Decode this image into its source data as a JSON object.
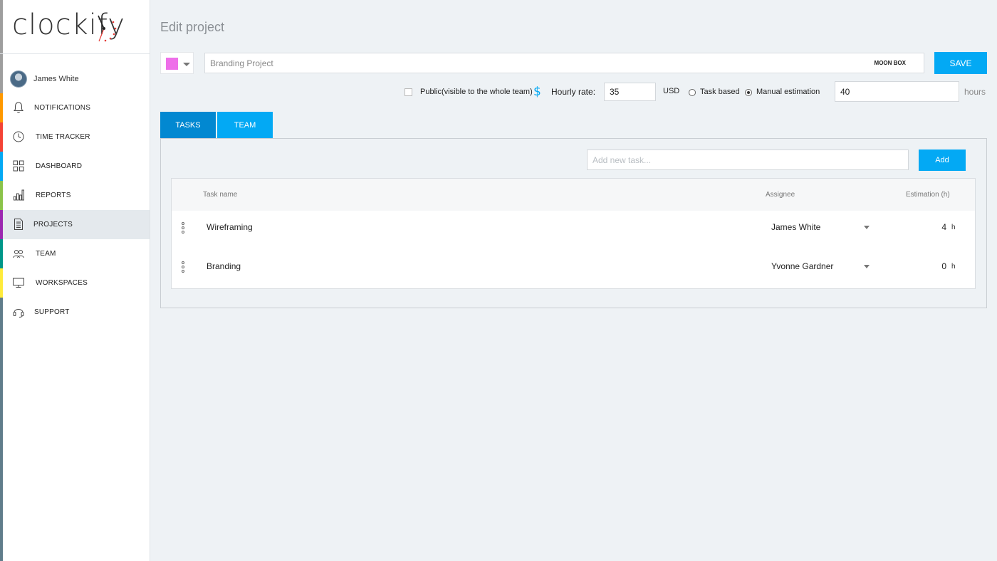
{
  "app": {
    "logo_text": "clockify"
  },
  "user": {
    "name": "James White"
  },
  "sidebar": {
    "items": [
      {
        "label": "NOTIFICATIONS",
        "icon": "bell-icon"
      },
      {
        "label": "TIME TRACKER",
        "icon": "clock-icon"
      },
      {
        "label": "DASHBOARD",
        "icon": "grid-icon"
      },
      {
        "label": "REPORTS",
        "icon": "bar-chart-icon"
      },
      {
        "label": "PROJECTS",
        "icon": "document-icon",
        "active": true
      },
      {
        "label": "TEAM",
        "icon": "people-icon"
      },
      {
        "label": "WORKSPACES",
        "icon": "monitor-icon"
      },
      {
        "label": "SUPPORT",
        "icon": "headset-icon"
      }
    ],
    "edge_colors": [
      "#9e9e9e",
      "#ff9800",
      "#f44336",
      "#03a9f4",
      "#8bc34a",
      "#9c27b0",
      "#009688",
      "#ffeb3b",
      "#607d8b"
    ]
  },
  "page": {
    "title": "Edit project"
  },
  "project": {
    "color": "#ee6fe9",
    "name_placeholder": "Branding Project",
    "client": "MOON BOX",
    "save_label": "SAVE"
  },
  "options": {
    "public_label": "Public(visible to the whole team)",
    "public_checked": false,
    "rate_label": "Hourly rate:",
    "rate_value": "35",
    "currency": "USD",
    "task_based_label": "Task based",
    "manual_label": "Manual estimation",
    "estimation_selected": "manual",
    "estimate_value": "40",
    "hours_unit": "hours"
  },
  "tabs": [
    {
      "label": "TASKS",
      "active": true
    },
    {
      "label": "TEAM",
      "active": false
    }
  ],
  "tasks": {
    "new_placeholder": "Add new task...",
    "add_label": "Add",
    "headers": {
      "name": "Task name",
      "assignee": "Assignee",
      "estimation": "Estimation (h)"
    },
    "rows": [
      {
        "name": "Wireframing",
        "assignee": "James White",
        "estimate": "4",
        "unit": "h"
      },
      {
        "name": "Branding",
        "assignee": "Yvonne Gardner",
        "estimate": "0",
        "unit": "h"
      }
    ]
  }
}
